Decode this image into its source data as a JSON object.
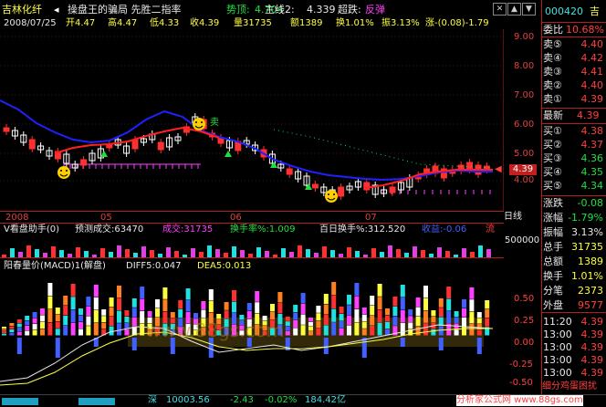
{
  "header": {
    "stock_name": "吉林化纤",
    "nav_back": "◂",
    "formula": "操盘王的骗局 先胜二指率",
    "trend_label": "势顶:",
    "trend_value": "4.704",
    "main_label": "主线2:",
    "main_value": "4.339",
    "signal_label": "超跌:",
    "signal_value": "反弹"
  },
  "ohlc": {
    "date": "2008/07/25",
    "open": "开4.47",
    "high": "高4.47",
    "low": "低4.33",
    "close": "收4.39",
    "volume": "量31735",
    "amount": "额1389",
    "turnover": "换1.01%",
    "amplitude": "振3.13%",
    "change": "涨-(0.08)-1.79"
  },
  "price_axis": [
    "9.00",
    "8.00",
    "7.00",
    "6.00",
    "5.00",
    "4.00"
  ],
  "current_price_tag": "4.39",
  "time_axis": [
    "2008",
    "05",
    "06",
    "07"
  ],
  "period_label": "日线",
  "chart_marks": {
    "sell": "卖"
  },
  "volume_panel": {
    "title": "V看盘助手(0)",
    "predicted": "预测成交:63470",
    "volume": "成交:31735",
    "turnover": "换手率%:1.009",
    "hundred_day": "百日换手%:312.520",
    "profit": "收益:-0.06",
    "flow": "流",
    "axis_label": "500000"
  },
  "macd_panel": {
    "title": "阳春量价(MACD)1(解盘)",
    "diff": "DIFF5:0.047",
    "dea": "DEA5:0.013",
    "axis": [
      "0.50",
      "0.25",
      "0.00",
      "-0.25",
      "-0.50"
    ],
    "watermark": "www.88gs.com"
  },
  "right_panel": {
    "code": "000420",
    "name": "吉",
    "committee_ratio_label": "委比",
    "committee_ratio_value": "10.68%",
    "asks": [
      {
        "label": "卖⑤",
        "price": "4.40"
      },
      {
        "label": "卖④",
        "price": "4.42"
      },
      {
        "label": "卖③",
        "price": "4.41"
      },
      {
        "label": "卖②",
        "price": "4.40"
      },
      {
        "label": "卖①",
        "price": "4.39"
      }
    ],
    "last_label": "最新",
    "last_value": "4.39",
    "bids": [
      {
        "label": "买①",
        "price": "4.38"
      },
      {
        "label": "买②",
        "price": "4.37"
      },
      {
        "label": "买③",
        "price": "4.36"
      },
      {
        "label": "买④",
        "price": "4.35"
      },
      {
        "label": "买⑤",
        "price": "4.34"
      }
    ],
    "stats": [
      {
        "label": "涨跌",
        "value": "-0.08"
      },
      {
        "label": "涨幅",
        "value": "-1.79%"
      },
      {
        "label": "振幅",
        "value": "3.13%"
      },
      {
        "label": "总手",
        "value": "31735"
      },
      {
        "label": "总额",
        "value": "1389"
      },
      {
        "label": "换手",
        "value": "1.01%"
      },
      {
        "label": "分笔",
        "value": "2373"
      },
      {
        "label": "外盘",
        "value": "9577"
      }
    ],
    "ticks": [
      {
        "time": "11:20",
        "price": "4.39"
      },
      {
        "time": "13:00",
        "price": "4.39"
      },
      {
        "time": "13:00",
        "price": "4.39"
      },
      {
        "time": "13:00",
        "price": "4.39"
      },
      {
        "time": "13:00",
        "price": "4.39"
      }
    ],
    "promo": "细分鸡蛋困扰"
  },
  "status_bar": {
    "index_name": "深",
    "index_value": "10003.56",
    "index_change": "-2.43",
    "index_pct": "-0.02%",
    "index_amount": "184.42亿",
    "promo": "分析家公式网 www.88gs.com"
  }
}
